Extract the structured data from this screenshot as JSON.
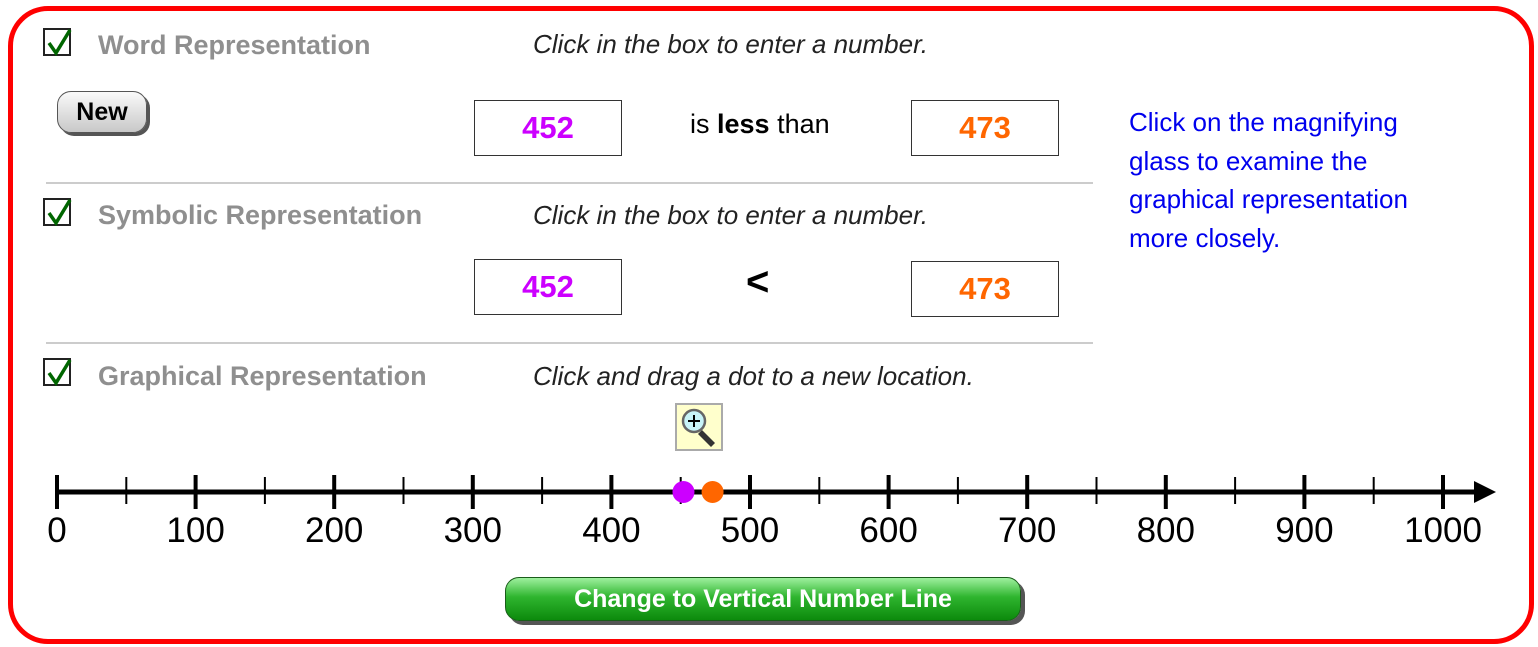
{
  "sections": {
    "word": {
      "checked": true,
      "heading": "Word Representation",
      "instruction": "Click in the box to enter a number.",
      "new_button": "New",
      "left_value": "452",
      "relation_prefix": "is",
      "relation_word": "less",
      "relation_suffix": "than",
      "right_value": "473"
    },
    "symbolic": {
      "checked": true,
      "heading": "Symbolic Representation",
      "instruction": "Click in the box to enter a number.",
      "left_value": "452",
      "symbol": "<",
      "right_value": "473"
    },
    "graphical": {
      "checked": true,
      "heading": "Graphical Representation",
      "instruction": "Click and drag a dot to a new location.",
      "magnifier_icon": "magnifying-glass-plus-icon"
    }
  },
  "hint": "Click on the magnifying glass to examine the graphical representation more closely.",
  "change_button": "Change to Vertical Number Line",
  "colors": {
    "left_number": "#cc00ff",
    "right_number": "#ff6600",
    "hint_text": "#0000ee",
    "frame": "#ff0000",
    "heading": "#8f8f8f",
    "checkmark": "#006600"
  },
  "number_line": {
    "min": 0,
    "max": 1000,
    "major_step": 100,
    "minor_step": 50,
    "labels": [
      "0",
      "100",
      "200",
      "300",
      "400",
      "500",
      "600",
      "700",
      "800",
      "900",
      "1000"
    ],
    "points": [
      {
        "name": "left-dot",
        "value": 452,
        "color": "#cc00ff"
      },
      {
        "name": "right-dot",
        "value": 473,
        "color": "#ff6600"
      }
    ]
  }
}
